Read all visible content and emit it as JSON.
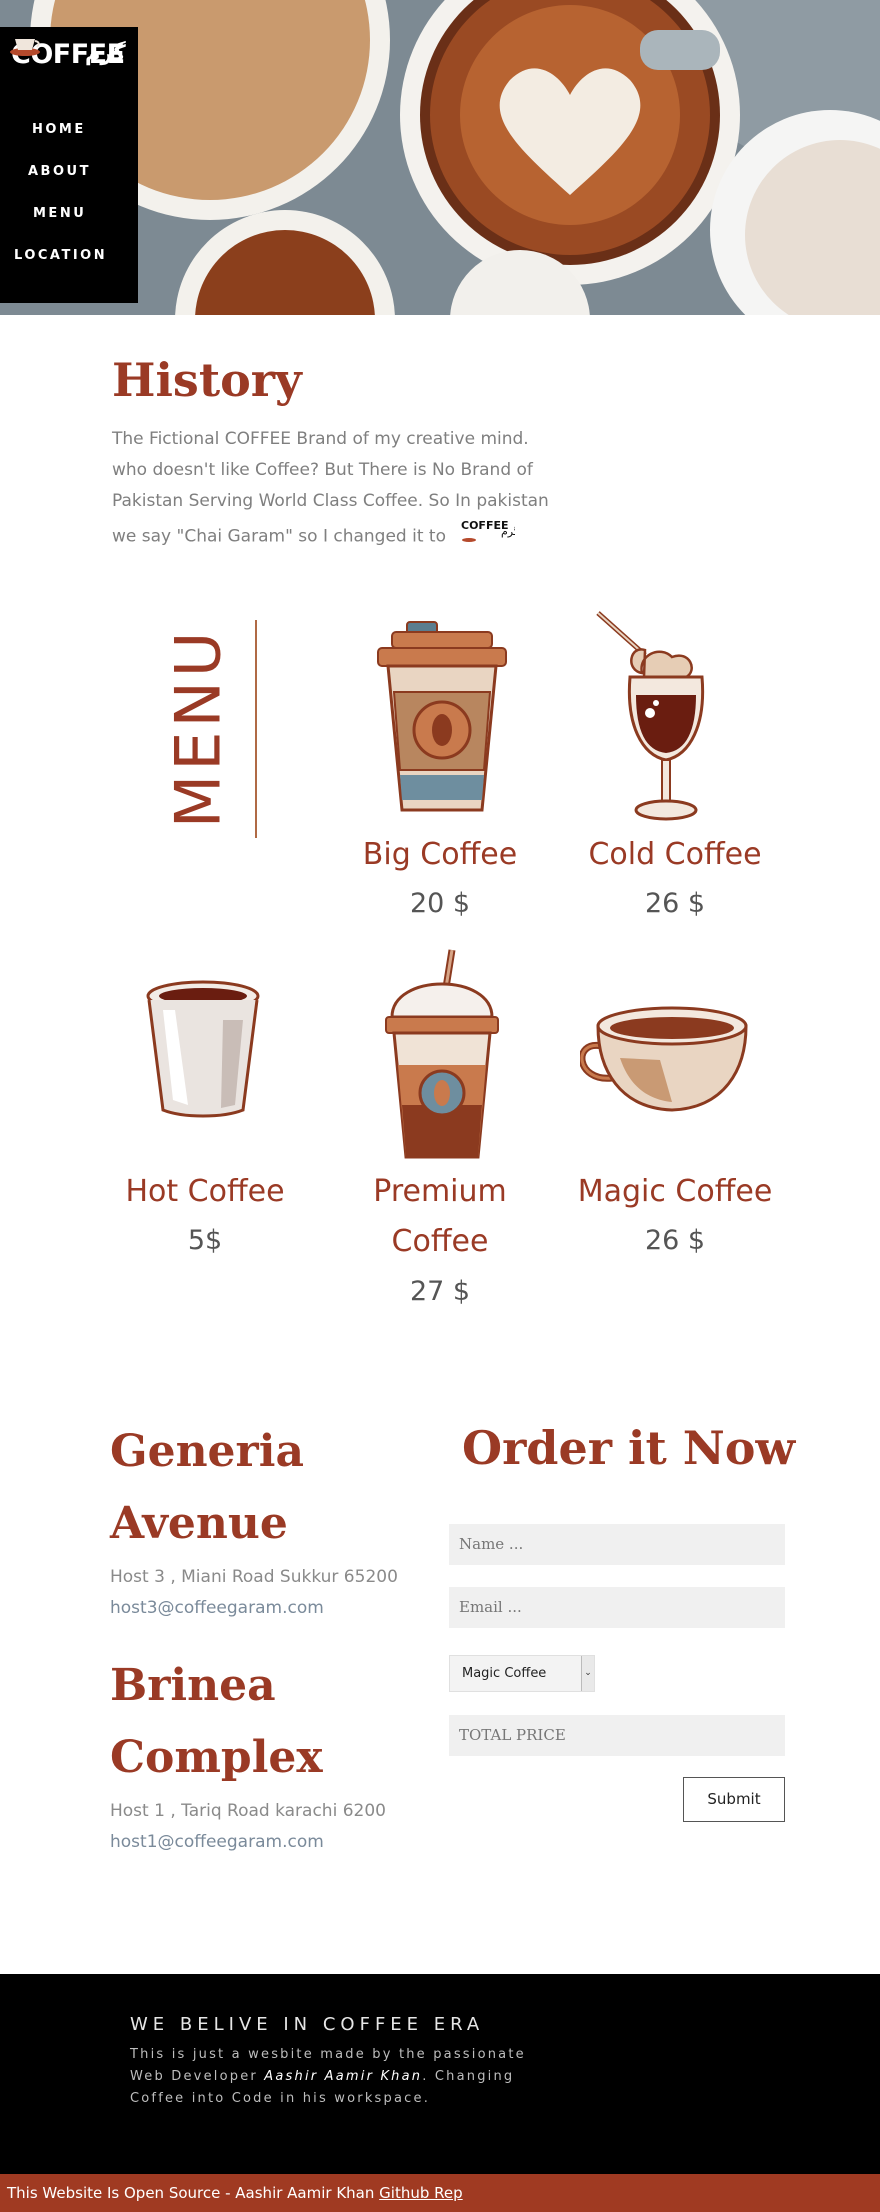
{
  "brand": {
    "name": "COFFEE",
    "urdu": "گرم"
  },
  "nav": {
    "items": [
      "HOME",
      "ABOUT",
      "MENU",
      "LOCATION"
    ]
  },
  "history": {
    "title": "History",
    "text": "The Fictional COFFEE Brand of my creative mind. who doesn't like Coffee? But There is No Brand of Pakistan Serving World Class Coffee. So In pakistan we say \"Chai Garam\" so I changed it to"
  },
  "menu": {
    "label": "MENU",
    "products": [
      {
        "name": "Big Coffee",
        "price": "20 $"
      },
      {
        "name": "Cold Coffee",
        "price": "26 $"
      },
      {
        "name": "Hot Coffee",
        "price": "5$"
      },
      {
        "name": "Premium Coffee",
        "price": "27 $"
      },
      {
        "name": "Magic Coffee",
        "price": "26 $"
      }
    ]
  },
  "locations": [
    {
      "title": "Generia Avenue",
      "address": "Host 3 , Miani Road Sukkur 65200",
      "email": "host3@coffeegaram.com"
    },
    {
      "title": "Brinea Complex",
      "address": "Host 1 , Tariq Road karachi 6200",
      "email": "host1@coffeegaram.com"
    }
  ],
  "order": {
    "title": "Order it Now",
    "name_placeholder": "Name ...",
    "email_placeholder": "Email ...",
    "selected_product": "Magic Coffee",
    "total_placeholder": "TOTAL PRICE",
    "submit_label": "Submit"
  },
  "footer": {
    "heading": "WE BELIVE IN COFFEE ERA",
    "text_before": "This is just a wesbite made by the passionate Web Developer",
    "author": "Aashir Aamir Khan",
    "text_after": ". Changing Coffee into Code in his workspace."
  },
  "bottom_bar": {
    "text": "This Website Is Open Source - Aashir Aamir Khan",
    "link_label": "Github Rep"
  },
  "colors": {
    "accent": "#9a3a25",
    "bar": "#a03a22",
    "nav_bg": "#000000"
  }
}
